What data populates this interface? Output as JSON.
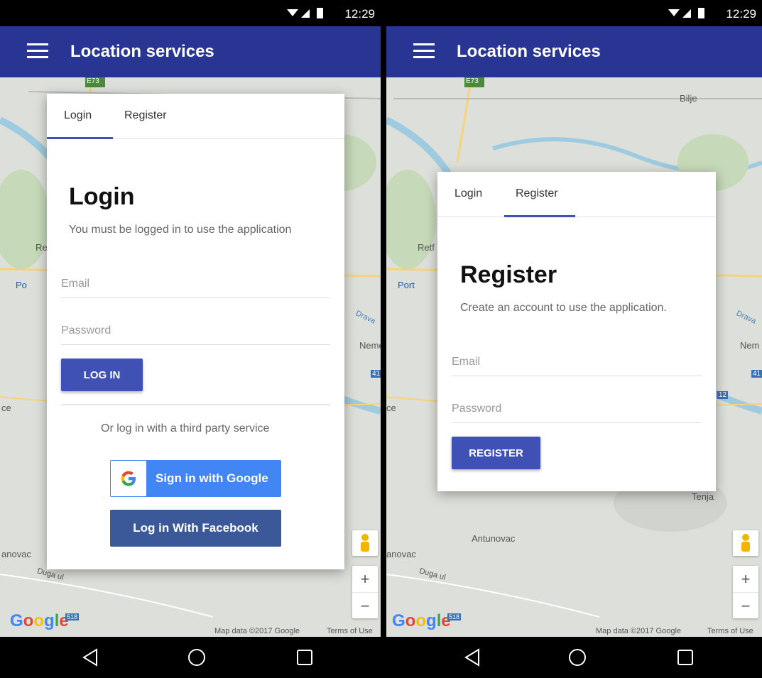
{
  "status_bar": {
    "time": "12:29"
  },
  "app_bar": {
    "title": "Location services"
  },
  "colors": {
    "app_bar": "#283593",
    "accent": "#3f51b5",
    "google_blue": "#4285f4",
    "facebook_blue": "#3b5998"
  },
  "map": {
    "labels_left": [
      "Re",
      "Po",
      "Neme",
      "41",
      "ce",
      "anovac",
      "Duga ul",
      "Drava"
    ],
    "labels_right": [
      "Bilje",
      "Retf",
      "Port",
      "Nem",
      "41",
      "12",
      "ce",
      "Tenja",
      "Antunovac",
      "anovac",
      "Duga ul",
      "Drava"
    ],
    "road_sign": "E73",
    "google_logo": "Google",
    "google_badge": "518",
    "map_data": "Map data ©2017 Google",
    "terms": "Terms of Use",
    "zoom_in": "+",
    "zoom_out": "−"
  },
  "login_screen": {
    "tabs": [
      "Login",
      "Register"
    ],
    "active_tab": "Login",
    "title": "Login",
    "subtitle": "You must be logged in to use the application",
    "email_placeholder": "Email",
    "password_placeholder": "Password",
    "submit_label": "LOG IN",
    "third_party_text": "Or log in with a third party service",
    "google_button": "Sign in with Google",
    "facebook_button": "Log in With Facebook"
  },
  "register_screen": {
    "tabs": [
      "Login",
      "Register"
    ],
    "active_tab": "Register",
    "title": "Register",
    "subtitle": "Create an account to use the application.",
    "email_placeholder": "Email",
    "password_placeholder": "Password",
    "submit_label": "REGISTER"
  },
  "nav_bar": {
    "icons": [
      "back-icon",
      "home-icon",
      "recents-icon"
    ]
  }
}
